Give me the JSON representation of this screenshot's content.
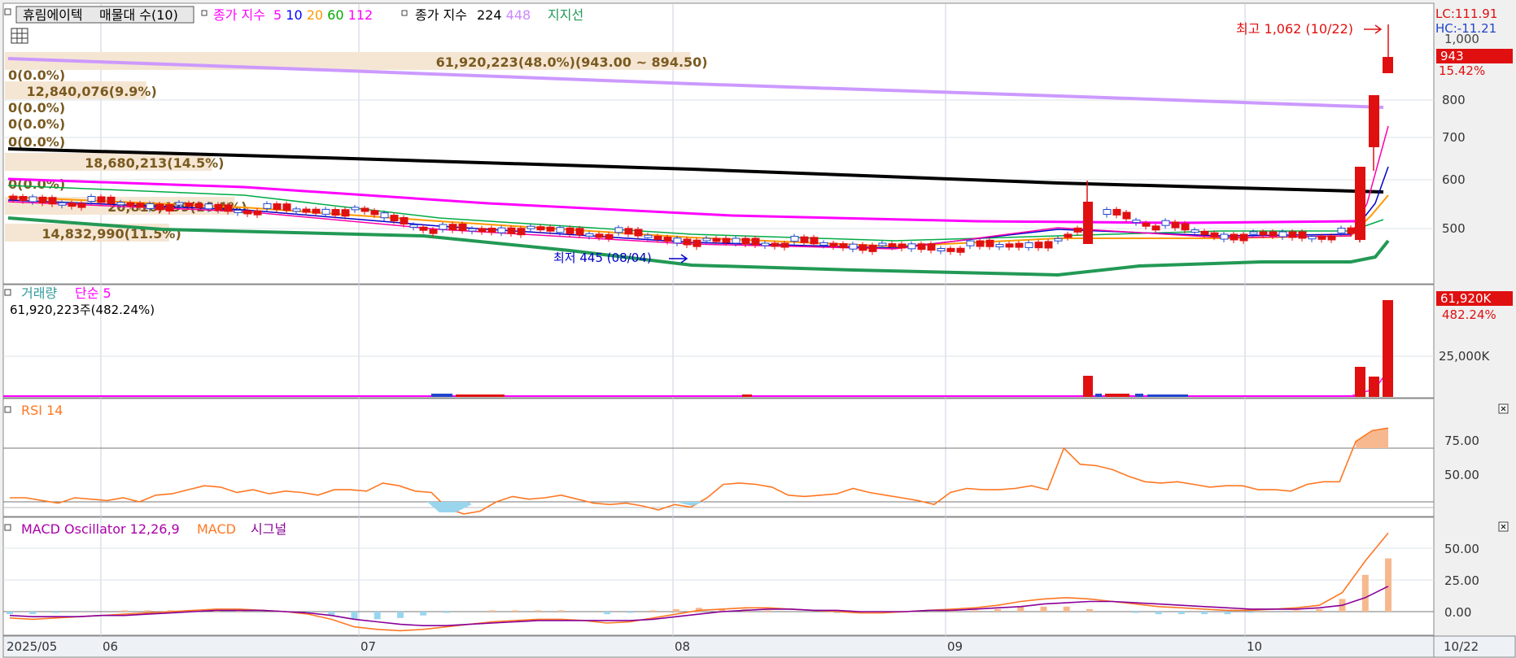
{
  "header": {
    "stock_name": "휴림에이텍",
    "volume_profile_label": "매물대 수(10)",
    "ma_label": "종가 지수",
    "ma_periods": [
      "5",
      "10",
      "20",
      "60",
      "112"
    ],
    "ma_colors": [
      "#ff00ff",
      "#0000ff",
      "#ff9900",
      "#00aa00",
      "#ff00ff"
    ],
    "ma2_label": "종가 지수",
    "ma2_periods": [
      "224",
      "448"
    ],
    "ma2_colors": [
      "#000000",
      "#cc88ff"
    ],
    "support_label": "지지선"
  },
  "price_axis": {
    "lc": "LC:111.91",
    "hc": "HC:-11.21",
    "top_cut": "1,000",
    "current": "943",
    "change": "15.42%",
    "ticks": [
      "800",
      "700",
      "600",
      "500"
    ]
  },
  "annotations": {
    "high": "최고 1,062 (10/22)",
    "low": "최저 445 (08/04)"
  },
  "volume_profile": [
    {
      "label": "61,920,223(48.0%)(943.00 ~ 894.50)",
      "fraction": 0.48
    },
    {
      "label": "0(0.0%)",
      "fraction": 0.0
    },
    {
      "label": "12,840,076(9.9%)",
      "fraction": 0.099
    },
    {
      "label": "0(0.0%)",
      "fraction": 0.0
    },
    {
      "label": "0(0.0%)",
      "fraction": 0.0
    },
    {
      "label": "0(0.0%)",
      "fraction": 0.0
    },
    {
      "label": "18,680,213(14.5%)",
      "fraction": 0.145
    },
    {
      "label": "0(0.0%)",
      "fraction": 0.0
    },
    {
      "label": "20,810,499(16.1%)",
      "fraction": 0.161
    },
    {
      "label": "14,832,990(11.5%)",
      "fraction": 0.115
    }
  ],
  "volume_panel": {
    "title": "거래량",
    "ma_label": "단순 5",
    "info": "61,920,223주(482.24%)",
    "current": "61,920K",
    "pct": "482.24%",
    "tick": "25,000K"
  },
  "rsi_panel": {
    "title": "RSI 14",
    "ticks": [
      "75.00",
      "50.00"
    ]
  },
  "macd_panel": {
    "title": "MACD Oscillator 12,26,9",
    "macd_label": "MACD",
    "signal_label": "시그널",
    "ticks": [
      "50.00",
      "25.00",
      "0.00"
    ]
  },
  "x_axis": {
    "labels": [
      "2025/05",
      "06",
      "07",
      "08",
      "09",
      "10"
    ],
    "end_label": "10/22"
  },
  "chart_data": [
    {
      "type": "candlestick",
      "title": "휴림에이텍",
      "x": [
        "2025/05",
        "06",
        "07",
        "08",
        "09",
        "10",
        "10/22"
      ],
      "close": [
        553,
        550,
        535,
        470,
        462,
        470,
        485,
        943
      ],
      "high_marker": {
        "date": "10/22",
        "value": 1062
      },
      "low_marker": {
        "date": "08/04",
        "value": 445
      },
      "ylim": [
        430,
        1000
      ],
      "series": [
        {
          "name": "224",
          "color": "#000000",
          "values": [
            675,
            572
          ]
        },
        {
          "name": "448",
          "color": "#cc88ff",
          "values": [
            925,
            780
          ]
        },
        {
          "name": "112",
          "color": "#ff00ff",
          "values": [
            605,
            520
          ]
        },
        {
          "name": "지지선",
          "color": "#229955",
          "values": [
            520,
            478
          ]
        }
      ]
    },
    {
      "type": "bar",
      "title": "거래량",
      "last_value": "61,920,223",
      "ticks": [
        "25,000K"
      ]
    },
    {
      "type": "line",
      "title": "RSI 14",
      "ylim": [
        20,
        100
      ],
      "ticks": [
        75,
        50
      ],
      "values": [
        38,
        38,
        36,
        34,
        38,
        37,
        36,
        38,
        35,
        40,
        41,
        44,
        47,
        46,
        42,
        44,
        41,
        43,
        42,
        40,
        44,
        44,
        43,
        49,
        47,
        43,
        42,
        30,
        26,
        28,
        35,
        39,
        37,
        38,
        40,
        37,
        34,
        33,
        34,
        32,
        29,
        33,
        31,
        38,
        48,
        49,
        48,
        46,
        40,
        39,
        40,
        41,
        45,
        42,
        40,
        38,
        36,
        33,
        42,
        45,
        44,
        44,
        45,
        47,
        44,
        75,
        63,
        62,
        59,
        54,
        50,
        49,
        50,
        48,
        46,
        47,
        47,
        44,
        44,
        43,
        48,
        50,
        50,
        80,
        88,
        90
      ]
    },
    {
      "type": "line",
      "title": "MACD Oscillator 12,26,9",
      "ylim": [
        -20,
        70
      ],
      "ticks": [
        50,
        25,
        0
      ],
      "series": [
        {
          "name": "MACD",
          "color": "#ff7722",
          "values": [
            -5,
            -6,
            -5,
            -4,
            -3,
            -2,
            -1,
            0,
            1,
            2,
            2,
            1,
            0,
            -2,
            -6,
            -12,
            -14,
            -15,
            -14,
            -12,
            -10,
            -8,
            -7,
            -6,
            -6,
            -7,
            -9,
            -8,
            -5,
            -2,
            1,
            2,
            3,
            3,
            2,
            1,
            0,
            -1,
            -1,
            0,
            1,
            2,
            3,
            5,
            8,
            10,
            11,
            10,
            8,
            6,
            4,
            3,
            2,
            1,
            1,
            2,
            3,
            5,
            15,
            40,
            62
          ]
        },
        {
          "name": "시그널",
          "color": "#880099",
          "values": [
            -3,
            -4,
            -4,
            -4,
            -3,
            -3,
            -2,
            -1,
            0,
            1,
            1,
            1,
            0,
            -1,
            -3,
            -6,
            -8,
            -10,
            -11,
            -11,
            -10,
            -9,
            -8,
            -7,
            -7,
            -7,
            -7,
            -7,
            -6,
            -4,
            -2,
            0,
            1,
            2,
            2,
            1,
            1,
            0,
            0,
            0,
            1,
            1,
            2,
            3,
            4,
            6,
            7,
            8,
            8,
            7,
            6,
            5,
            4,
            3,
            2,
            2,
            2,
            3,
            5,
            11,
            20
          ]
        }
      ]
    }
  ]
}
